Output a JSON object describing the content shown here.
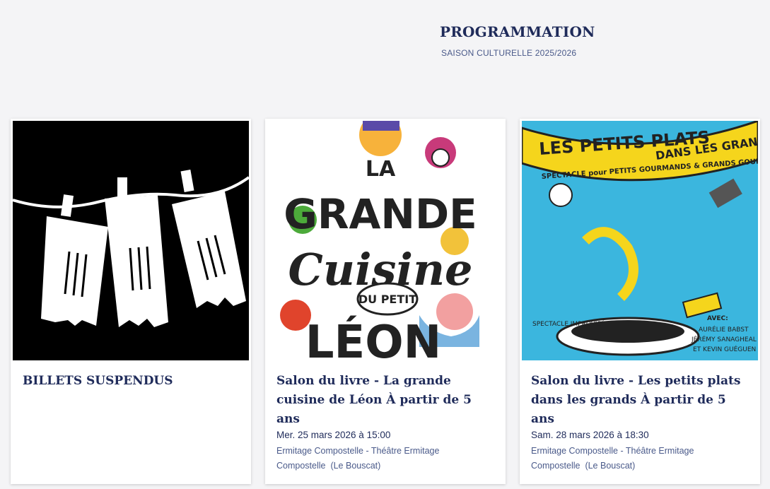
{
  "header": {
    "title": "PROGRAMMATION",
    "subtitle": "SAISON CULTURELLE 2025/2026"
  },
  "cards": [
    {
      "title": "BILLETS SUSPENDUS",
      "image": "hanging-tickets-illustration",
      "date": "",
      "venue": "",
      "city": ""
    },
    {
      "title": "Salon du livre - La grande cuisine de Léon À partir de 5 ans",
      "image": "la-grande-cuisine-du-petit-leon-poster",
      "poster_text": [
        "LA",
        "GRANDE",
        "Cuisine",
        "DU PETIT",
        "LÉON"
      ],
      "date": "Mer. 25 mars 2026 à 15:00",
      "venue": "Ermitage Compostelle - Théâtre Ermitage Compostelle",
      "city": "(Le Bouscat)"
    },
    {
      "title": "Salon du livre - Les petits plats dans les grands À partir de 5 ans",
      "image": "les-petits-plats-dans-les-grands-poster",
      "poster_text": [
        "LES PETITS PLATS",
        "DANS LES GRANDS",
        "SPECTACLE pour PETITS GOURMANDS & GRANDS GOURMETS",
        "SPECTACLE IMPROVISÉ",
        "AVEC:",
        "AURÉLIE BABST",
        "JÉRÉMY SANAGHEAL",
        "ET KEVIN GUÉGUEN"
      ],
      "date": "Sam. 28 mars 2026 à 18:30",
      "venue": "Ermitage Compostelle - Théâtre Ermitage Compostelle",
      "city": "(Le Bouscat)"
    }
  ],
  "colors": {
    "navy": "#1f2b5a",
    "muted_blue": "#4a5a8a",
    "background": "#f4f4f6",
    "poster_blue": "#3bb6de",
    "poster_yellow": "#f5d51c"
  }
}
